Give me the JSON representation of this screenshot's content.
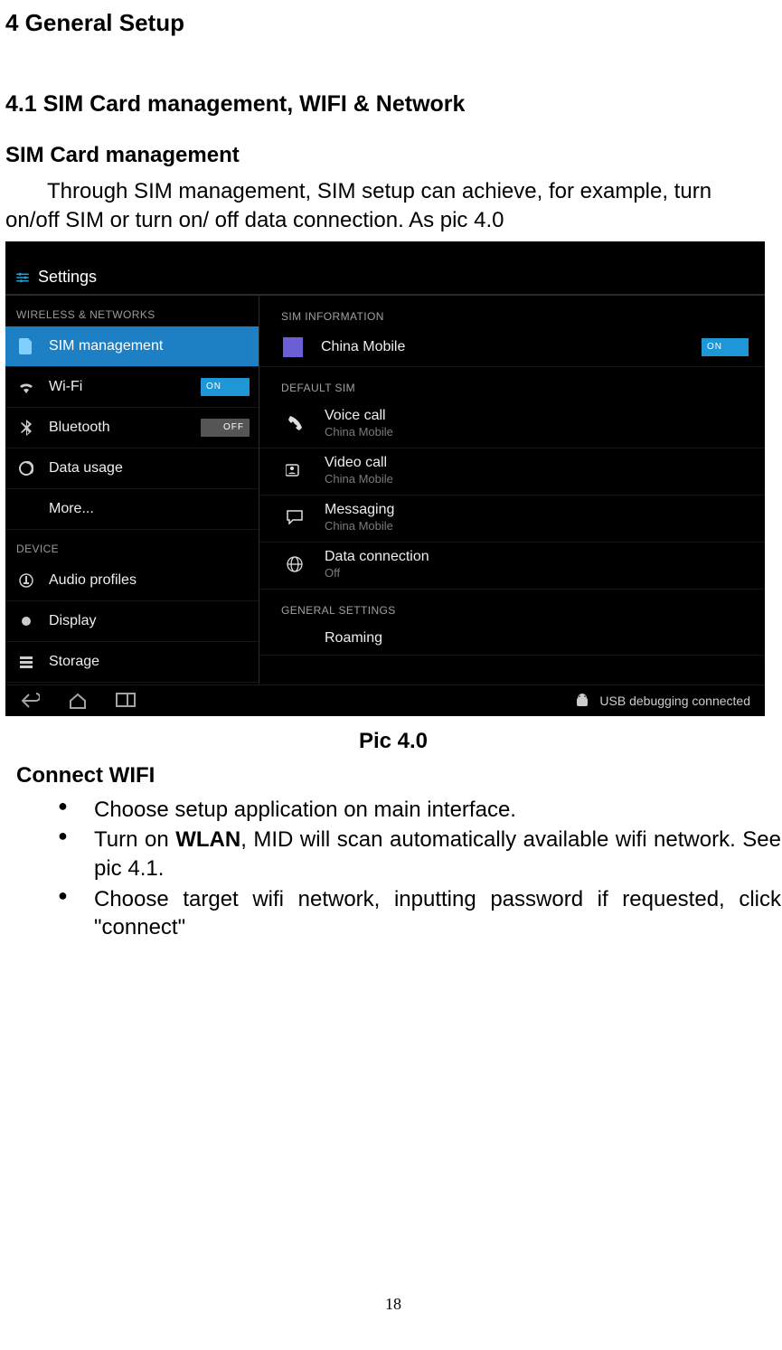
{
  "doc": {
    "h1": "4 General Setup",
    "h2": "4.1 SIM Card management, WIFI & Network",
    "h3_sim": "SIM Card management",
    "para_sim_1": "Through SIM management, SIM setup can achieve, for example, turn",
    "para_sim_2": "on/off SIM or turn on/ off data connection. As pic 4.0",
    "caption": "Pic 4.0",
    "h3_wifi": "Connect WIFI",
    "bullets": {
      "b1": "Choose setup application on main interface.",
      "b2a": "Turn on ",
      "b2b": "WLAN",
      "b2c": ", MID will scan automatically available wifi network. See pic 4.1.",
      "b3": "Choose target wifi network, inputting password if requested, click \"connect\""
    },
    "page_number": "18"
  },
  "shot": {
    "title": "Settings",
    "left_cat1": "WIRELESS & NETWORKS",
    "left_cat2": "DEVICE",
    "left_items": {
      "sim": "SIM management",
      "wifi": "Wi-Fi",
      "bt": "Bluetooth",
      "data": "Data usage",
      "more": "More...",
      "audio": "Audio profiles",
      "display": "Display",
      "storage": "Storage"
    },
    "toggles": {
      "on": "ON",
      "off": "OFF"
    },
    "right_cat1": "SIM INFORMATION",
    "right_cat2": "DEFAULT SIM",
    "right_cat3": "GENERAL SETTINGS",
    "right_items": {
      "carrier": "China Mobile",
      "voice": {
        "t": "Voice call",
        "s": "China Mobile"
      },
      "video": {
        "t": "Video call",
        "s": "China Mobile"
      },
      "msg": {
        "t": "Messaging",
        "s": "China Mobile"
      },
      "dataconn": {
        "t": "Data connection",
        "s": "Off"
      },
      "roaming": "Roaming"
    },
    "navbar": {
      "usb": "USB debugging connected"
    }
  }
}
